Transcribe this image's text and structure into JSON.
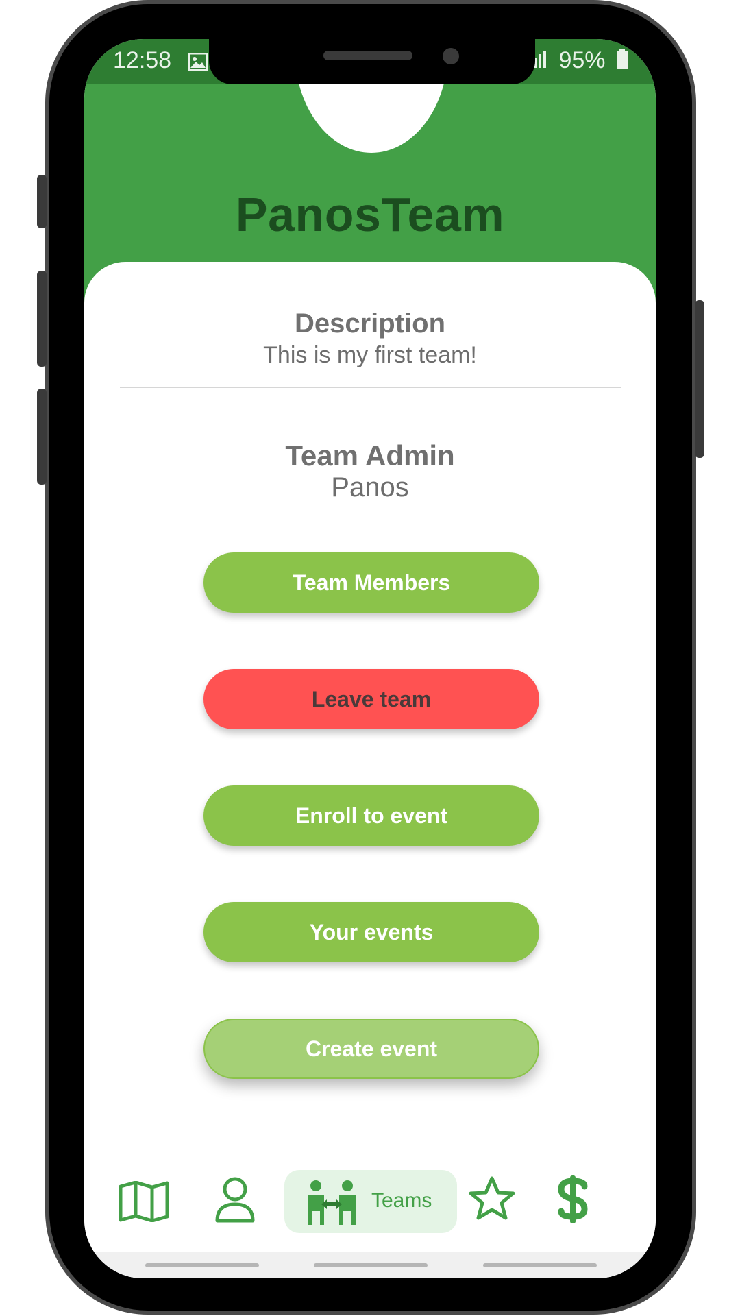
{
  "status_bar": {
    "time": "12:58",
    "battery": "95%"
  },
  "header": {
    "team_name": "PanosTeam"
  },
  "description": {
    "title": "Description",
    "value": "This is my first team!"
  },
  "admin": {
    "title": "Team Admin",
    "value": "Panos"
  },
  "actions": {
    "team_members": "Team Members",
    "leave_team": "Leave team",
    "enroll_event": "Enroll to event",
    "your_events": "Your events",
    "create_event": "Create event"
  },
  "bottom_nav": {
    "items": [
      {
        "icon": "map-icon"
      },
      {
        "icon": "profile-icon"
      },
      {
        "icon": "teams-icon",
        "label": "Teams"
      },
      {
        "icon": "star-icon"
      },
      {
        "icon": "dollar-icon"
      }
    ]
  },
  "colors": {
    "primary": "#43a047",
    "status_bar": "#2e7d32",
    "accent_button": "#8bc34a",
    "danger_button": "#ff5252"
  }
}
